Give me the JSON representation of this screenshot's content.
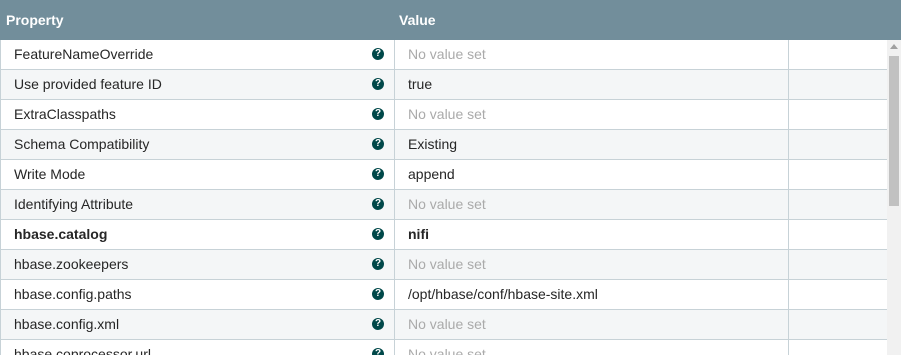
{
  "header": {
    "property_label": "Property",
    "value_label": "Value"
  },
  "help_glyph": "?",
  "rows": [
    {
      "name": "FeatureNameOverride",
      "value": "No value set",
      "unset": true,
      "bold": false
    },
    {
      "name": "Use provided feature ID",
      "value": "true",
      "unset": false,
      "bold": false
    },
    {
      "name": "ExtraClasspaths",
      "value": "No value set",
      "unset": true,
      "bold": false
    },
    {
      "name": "Schema Compatibility",
      "value": "Existing",
      "unset": false,
      "bold": false
    },
    {
      "name": "Write Mode",
      "value": "append",
      "unset": false,
      "bold": false
    },
    {
      "name": "Identifying Attribute",
      "value": "No value set",
      "unset": true,
      "bold": false
    },
    {
      "name": "hbase.catalog",
      "value": "nifi",
      "unset": false,
      "bold": true
    },
    {
      "name": "hbase.zookeepers",
      "value": "No value set",
      "unset": true,
      "bold": false
    },
    {
      "name": "hbase.config.paths",
      "value": "/opt/hbase/conf/hbase-site.xml",
      "unset": false,
      "bold": false
    },
    {
      "name": "hbase.config.xml",
      "value": "No value set",
      "unset": true,
      "bold": false
    },
    {
      "name": "hbase.coprocessor.url",
      "value": "No value set",
      "unset": true,
      "bold": false
    }
  ],
  "colors": {
    "header_bg": "#728e9b",
    "help_icon": "#004849",
    "unset_text": "#aaaaaa"
  }
}
